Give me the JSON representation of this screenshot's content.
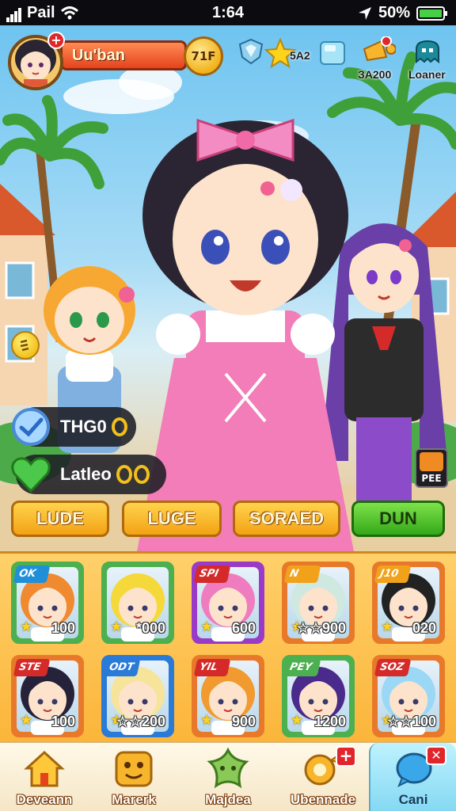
{
  "status_bar": {
    "carrier": "Pail",
    "time": "1:64",
    "battery": "50%"
  },
  "player": {
    "name": "Uu'ban",
    "level": "71F"
  },
  "hud": {
    "star_count": "5A2",
    "gift_label": "ЗA200",
    "loaner_label": "Loaner"
  },
  "side": {
    "pill1": "THG0",
    "pill2": "Latleo",
    "pee_label": "PEE"
  },
  "actions": [
    {
      "label": "LUDE",
      "style": "orange"
    },
    {
      "label": "LUGE",
      "style": "orange"
    },
    {
      "label": "SORAED",
      "style": "orange"
    },
    {
      "label": "DUN",
      "style": "green"
    }
  ],
  "roster": [
    {
      "tag": "OK",
      "value": "100",
      "hair": "#f08a30",
      "frame": "#4caf50",
      "tag_color": "#1f8fd8"
    },
    {
      "tag": "",
      "value": "*000",
      "hair": "#f5d83a",
      "frame": "#4caf50",
      "tag_color": "#4caf50"
    },
    {
      "tag": "SPI",
      "value": "600",
      "hair": "#f07cc0",
      "frame": "#9a3ac8",
      "tag_color": "#d42a2a"
    },
    {
      "tag": "N",
      "value": "☆☆900",
      "hair": "#cfe8e0",
      "frame": "#e8792a",
      "tag_color": "#f2a21a"
    },
    {
      "tag": "J10",
      "value": "020",
      "hair": "#222222",
      "frame": "#e8792a",
      "tag_color": "#f2a21a"
    },
    {
      "tag": "STE",
      "value": "100",
      "hair": "#25223a",
      "frame": "#e8792a",
      "tag_color": "#d42a2a"
    },
    {
      "tag": "ODT",
      "value": "☆☆200",
      "hair": "#f5e49a",
      "frame": "#2a7ad8",
      "tag_color": "#2a7ad8"
    },
    {
      "tag": "YIL",
      "value": "900",
      "hair": "#f09a30",
      "frame": "#e8792a",
      "tag_color": "#d42a2a"
    },
    {
      "tag": "PEY",
      "value": "1200",
      "hair": "#4a2a8a",
      "frame": "#4caf50",
      "tag_color": "#4caf50"
    },
    {
      "tag": "SOZ",
      "value": "☆☆100",
      "hair": "#9ad8f5",
      "frame": "#e8792a",
      "tag_color": "#d42a2a"
    }
  ],
  "nav": [
    {
      "label": "Deveann",
      "icon": "home-icon"
    },
    {
      "label": "Marerk",
      "icon": "face-block-icon"
    },
    {
      "label": "Majdea",
      "icon": "star-icon"
    },
    {
      "label": "Ubennade",
      "icon": "gacha-icon"
    },
    {
      "label": "Cani",
      "icon": "chat-icon"
    }
  ],
  "colors": {
    "accent_orange": "#f3a215",
    "accent_green": "#34a81a",
    "badge_red": "#e0262a"
  }
}
